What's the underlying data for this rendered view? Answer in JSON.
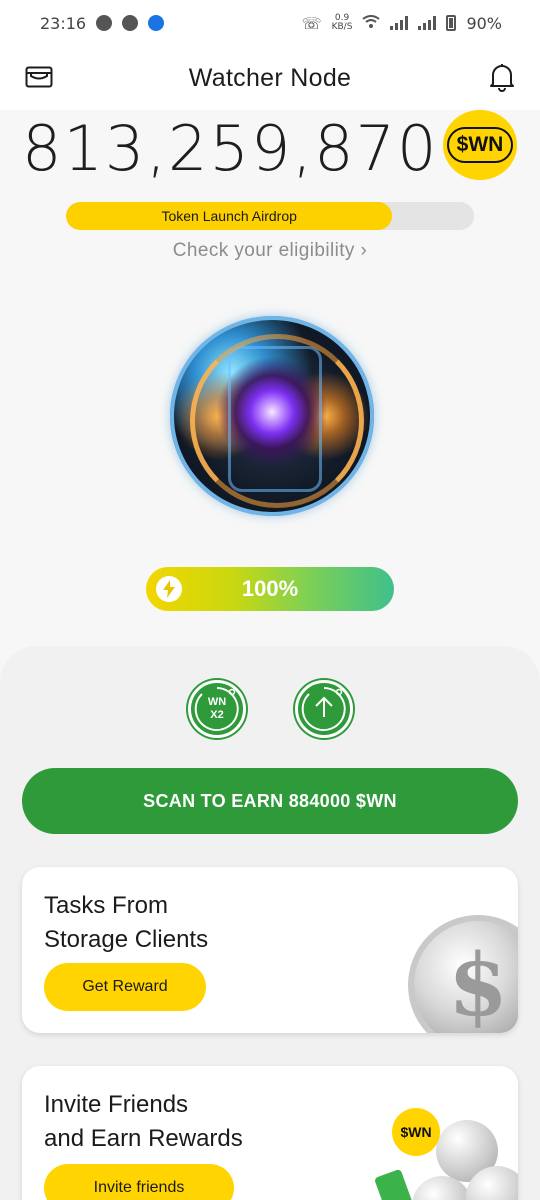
{
  "status_bar": {
    "time": "23:16",
    "network_speed_value": "0.9",
    "network_speed_unit": "KB/S",
    "battery": "90%"
  },
  "header": {
    "title": "Watcher Node"
  },
  "balance": {
    "amount": "813,259,870",
    "coin_label": "$WN"
  },
  "airdrop": {
    "label": "Token Launch Airdrop",
    "progress_fraction": 0.8,
    "eligibility_text": "Check your eligibility ›"
  },
  "energy": {
    "percent_text": "100%",
    "level_fraction": 1.0
  },
  "actions": {
    "boost_line1": "WN",
    "boost_line2": "X2",
    "scan_label": "SCAN TO EARN 884000 $WN"
  },
  "cards": {
    "tasks": {
      "title_line1": "Tasks From",
      "title_line2": "Storage Clients",
      "button_label": "Get Reward"
    },
    "invite": {
      "title_line1": "Invite Friends",
      "title_line2": "and Earn Rewards",
      "button_label": "Invite friends",
      "coin_label": "$WN"
    }
  },
  "colors": {
    "accent_green": "#2e9a3a",
    "accent_yellow": "#ffd400"
  },
  "icons": [
    "wallet-icon",
    "bell-icon",
    "lightning-icon",
    "arrow-up-icon",
    "dollar-coin-icon"
  ]
}
